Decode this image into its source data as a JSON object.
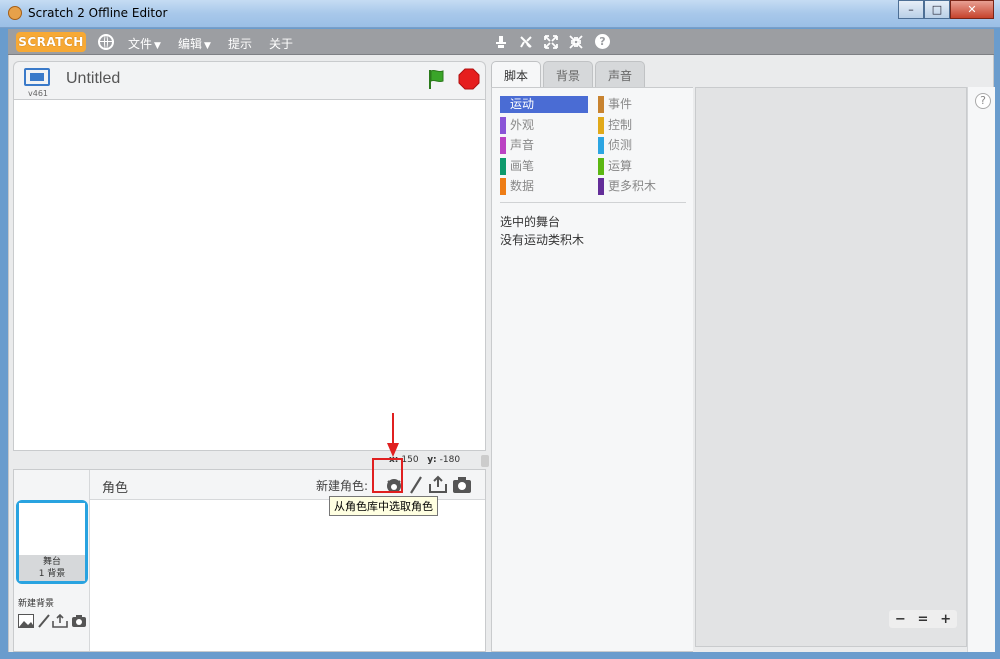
{
  "window": {
    "title": "Scratch 2 Offline Editor",
    "minimize": "–",
    "maximize": "□",
    "close": "✕"
  },
  "menubar": {
    "logo": "SCRATCH",
    "file": "文件",
    "edit": "编辑",
    "tips": "提示",
    "about": "关于",
    "help": "?",
    "icons": [
      "duplicate-icon",
      "delete-icon",
      "grow-icon",
      "shrink-icon",
      "help-icon"
    ]
  },
  "stage": {
    "project_title": "Untitled",
    "version": "v461",
    "coords": {
      "x_label": "x:",
      "x": "150",
      "y_label": "y:",
      "y": "-180"
    }
  },
  "sprites": {
    "title": "角色",
    "new_sprite_label": "新建角色:",
    "stage_thumb_name": "舞台",
    "stage_thumb_count": "1 背景",
    "new_backdrop_label": "新建背景",
    "tooltip": "从角色库中选取角色"
  },
  "tabs": [
    {
      "label": "脚本",
      "active": true
    },
    {
      "label": "背景",
      "active": false
    },
    {
      "label": "声音",
      "active": false
    }
  ],
  "palette": {
    "categories_left": [
      {
        "label": "运动",
        "color": "#4a6cd4",
        "selected": true
      },
      {
        "label": "外观",
        "color": "#8a55d7"
      },
      {
        "label": "声音",
        "color": "#bb42c3"
      },
      {
        "label": "画笔",
        "color": "#0e9a6c"
      },
      {
        "label": "数据",
        "color": "#ee7d16"
      }
    ],
    "categories_right": [
      {
        "label": "事件",
        "color": "#c88330"
      },
      {
        "label": "控制",
        "color": "#e1a91a"
      },
      {
        "label": "侦测",
        "color": "#2ca5e2"
      },
      {
        "label": "运算",
        "color": "#5cb712"
      },
      {
        "label": "更多积木",
        "color": "#632d99"
      }
    ],
    "message_line1": "选中的舞台",
    "message_line2": "没有运动类积木"
  },
  "script_area": {
    "help": "?",
    "zoom_out": "−",
    "zoom_reset": "=",
    "zoom_in": "+"
  },
  "colors": {
    "menubar": "#9c9ea2",
    "accent_blue": "#29a3e0",
    "annotation_red": "#e02020"
  }
}
